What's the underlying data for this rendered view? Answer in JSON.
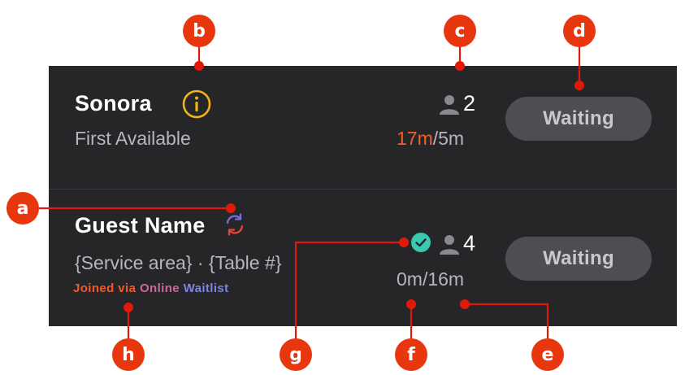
{
  "rows": [
    {
      "name": "Sonora",
      "subtitle": "First Available",
      "party_size": "2",
      "time_late": "17m",
      "time_rest": "/5m",
      "status_button": "Waiting"
    },
    {
      "name": "Guest Name",
      "subtitle": "{Service area} · {Table #}",
      "joined_prefix": "Joined via ",
      "joined_online": "Online ",
      "joined_waitlist": "Waitlist",
      "party_size": "4",
      "time": "0m/16m",
      "status_button": "Waiting"
    }
  ],
  "callouts": [
    "a",
    "b",
    "c",
    "d",
    "e",
    "f",
    "g",
    "h"
  ],
  "colors": {
    "panel": "#262629",
    "callout": "#e8360f",
    "late_time": "#f0602a",
    "info_icon": "#f2b413",
    "check_badge": "#3cc8b0"
  },
  "icons": [
    "info-icon",
    "person-icon",
    "sync-icon",
    "check-circle-icon"
  ]
}
